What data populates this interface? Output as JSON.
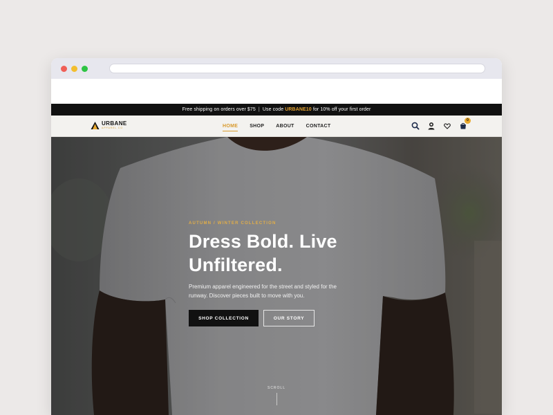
{
  "browser": {
    "colors": {
      "close": "#f05f57",
      "minimize": "#f3be2f",
      "maximize": "#2ec444"
    }
  },
  "promo": {
    "text_before": "Free shipping on orders over $75",
    "separator": "|",
    "text_code_prefix": "Use code",
    "code": "URBANE10",
    "text_after": "for 10% off your first order"
  },
  "brand": {
    "name": "URBANE",
    "tagline": "APPAREL CO",
    "accent_color": "#d89a2d"
  },
  "nav": {
    "items": [
      {
        "label": "HOME",
        "active": true
      },
      {
        "label": "SHOP",
        "active": false
      },
      {
        "label": "ABOUT",
        "active": false
      },
      {
        "label": "CONTACT",
        "active": false
      }
    ]
  },
  "header_icons": {
    "search": "search-icon",
    "account": "user-icon",
    "wishlist": "heart-icon",
    "cart": "cart-icon",
    "cart_count": "0"
  },
  "hero": {
    "eyebrow": "AUTUMN / WINTER COLLECTION",
    "headline_line1": "Dress Bold. Live",
    "headline_line2": "Unfiltered.",
    "subcopy": "Premium apparel engineered for the street and styled for the runway. Discover pieces built to move with you.",
    "primary_cta": "SHOP COLLECTION",
    "secondary_cta": "OUR STORY",
    "scroll_label": "SCROLL"
  }
}
